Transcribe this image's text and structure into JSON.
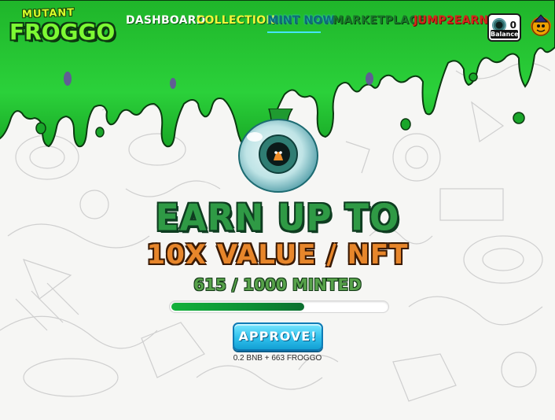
{
  "brand": {
    "logo_line1": "MUTANT",
    "logo_line2": "FROGGO"
  },
  "nav": {
    "items": [
      {
        "label": "DASHBOARD"
      },
      {
        "label": "COLLECTION"
      },
      {
        "label": "MINT NOW",
        "active": true
      },
      {
        "label": "MARKETPLACE"
      },
      {
        "label": "JUMP2EARN"
      }
    ]
  },
  "balance": {
    "value": "0",
    "label": "Balance",
    "icon": "eyeball-icon"
  },
  "hero": {
    "line1": "EARN UP TO",
    "line2": "10X VALUE / NFT",
    "minted_text": "615 / 1000 MINTED",
    "minted_fraction": 0.615
  },
  "approve": {
    "label": "APPROVE!",
    "price": "0.2 BNB + 663 FROGGO"
  },
  "colors": {
    "slime_green": "#24c633",
    "approve_blue": "#2fc0ec",
    "hero_green": "#2f9a45",
    "hero_orange": "#e7862b",
    "progress_green": "#0b8f35"
  }
}
